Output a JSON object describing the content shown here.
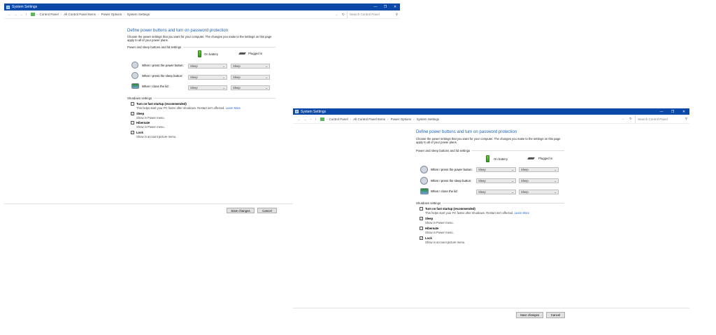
{
  "window": {
    "title": "System Settings",
    "controls": {
      "minimize": "—",
      "maximize": "❐",
      "close": "✕"
    }
  },
  "address": {
    "breadcrumbs": [
      "Control Panel",
      "All Control Panel Items",
      "Power Options",
      "System Settings"
    ],
    "search_placeholder": "Search Control Panel",
    "back": "←",
    "forward": "→",
    "down": "⌄",
    "up": "↑",
    "dropdown": "⌄",
    "refresh": "↻",
    "search_icon": "⚲"
  },
  "page": {
    "title": "Define power buttons and turn on password protection",
    "description": "Choose the power settings that you want for your computer. The changes you make to the settings on this page apply to all of your power plans.",
    "power_section": "Power and sleep buttons and lid settings",
    "columns": {
      "battery": "On battery",
      "plugged": "Plugged in"
    },
    "rows": [
      {
        "label": "When I press the power button:",
        "battery": "Sleep",
        "plugged": "Sleep",
        "icon": "power-icon"
      },
      {
        "label": "When I press the sleep button:",
        "battery": "Sleep",
        "plugged": "Sleep",
        "icon": "sleep-icon"
      },
      {
        "label": "When I close the lid:",
        "battery": "Sleep",
        "plugged": "Sleep",
        "icon": "lid-icon"
      }
    ],
    "shutdown_section": "Shutdown settings",
    "shutdown": [
      {
        "label": "Turn on fast startup (recommended)",
        "sub": "This helps start your PC faster after shutdown. Restart isn't affected.",
        "link": "Learn More",
        "checked": false
      },
      {
        "label": "Sleep",
        "sub": "Show in Power menu.",
        "checked": true
      },
      {
        "label": "Hibernate",
        "sub": "Show in Power menu.",
        "checked": false
      },
      {
        "label": "Lock",
        "sub": "Show in account picture menu.",
        "checked": true
      }
    ],
    "buttons": {
      "save": "Save changes",
      "cancel": "Cancel"
    }
  },
  "colors": {
    "titlebar": "#0a49a8",
    "heading": "#1e5fb4",
    "link": "#1e64c8"
  }
}
